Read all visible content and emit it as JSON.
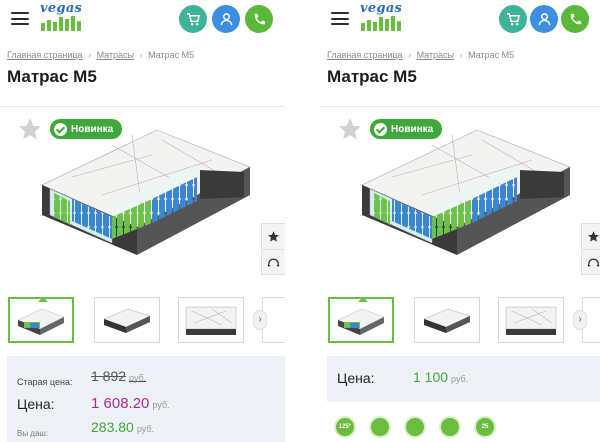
{
  "colors": {
    "accent_green": "#3fa83b",
    "button_teal": "#3fb397",
    "button_blue": "#3b8ee0",
    "price_purple": "#b02a8d"
  },
  "screens": [
    {
      "header": {
        "logo_text": "vegas",
        "cart_icon": "cart-icon",
        "user_icon": "user-icon",
        "phone_icon": "phone-icon"
      },
      "breadcrumbs": {
        "home": "Главная страница",
        "sep": "›",
        "category": "Матрасы",
        "current": "Матрас М5"
      },
      "title": "Матрас М5",
      "badge_label": "Новинка",
      "price": {
        "old_label": "Старая цена:",
        "old_value": "1 892",
        "currency": "руб.",
        "now_label": "Цена:",
        "now_value": "1 608.20",
        "save_label": "Вы даш:",
        "save_value": "283.80"
      }
    },
    {
      "header": {
        "logo_text": "vegas"
      },
      "breadcrumbs": {
        "home": "Главная страница",
        "sep": "›",
        "category": "Матрасы",
        "current": "Матрас М5"
      },
      "title": "Матрас М5",
      "badge_label": "Новинка",
      "price": {
        "now_label": "Цена:",
        "now_value": "1 100",
        "currency": "руб."
      },
      "features": [
        "125°",
        "",
        "",
        "",
        "25"
      ]
    }
  ]
}
